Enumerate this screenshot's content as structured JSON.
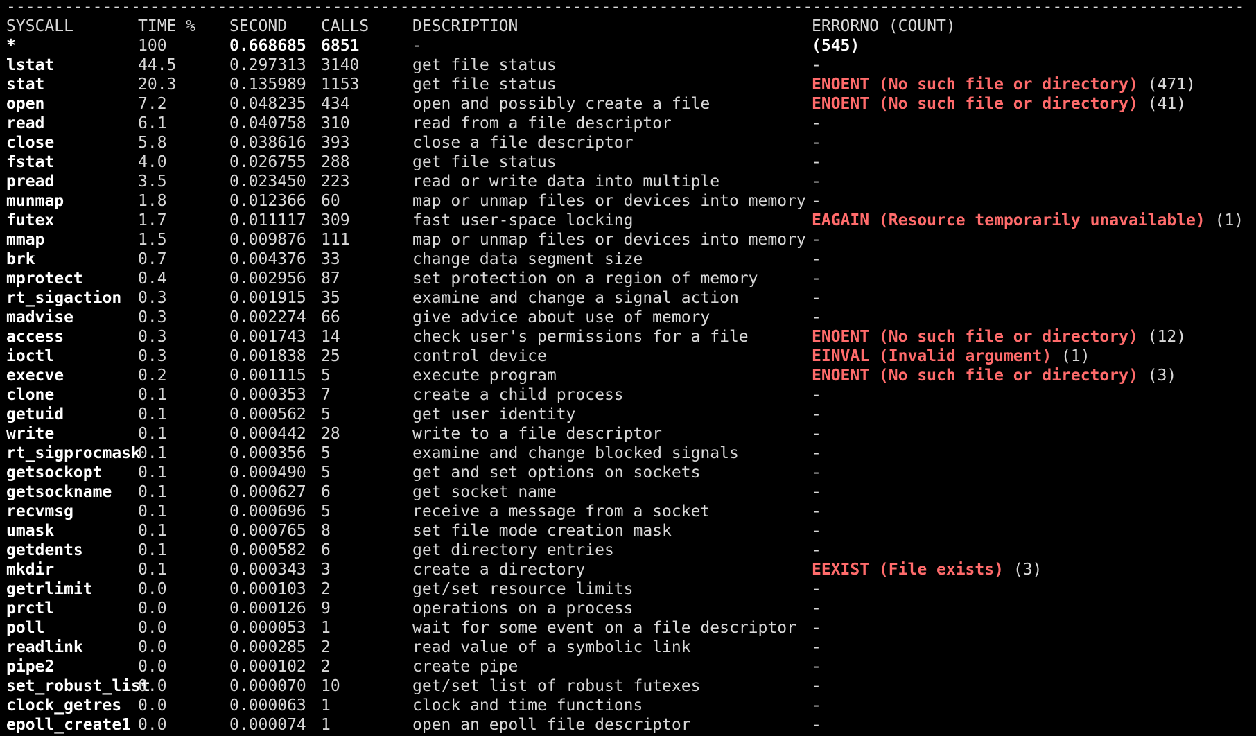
{
  "separator": "----------------------------------------------------------------------------------------------------------------------------------------------------------------------------------------",
  "header": {
    "syscall": "SYSCALL",
    "time": "TIME %",
    "second": "SECOND",
    "calls": "CALLS",
    "description": "DESCRIPTION",
    "errno": "ERRORNO (COUNT)"
  },
  "total": {
    "syscall": "*",
    "time": "100",
    "second": "0.668685",
    "calls": "6851",
    "description": "-",
    "errno": "(545)"
  },
  "rows": [
    {
      "syscall": "lstat",
      "time": "44.5",
      "second": "0.297313",
      "calls": "3140",
      "description": "get file status",
      "err_code": "",
      "err_count": "-"
    },
    {
      "syscall": "stat",
      "time": "20.3",
      "second": "0.135989",
      "calls": "1153",
      "description": "get file status",
      "err_code": "ENOENT (No such file or directory)",
      "err_count": "(471)"
    },
    {
      "syscall": "open",
      "time": "7.2",
      "second": "0.048235",
      "calls": "434",
      "description": "open and possibly create a file",
      "err_code": "ENOENT (No such file or directory)",
      "err_count": "(41)"
    },
    {
      "syscall": "read",
      "time": "6.1",
      "second": "0.040758",
      "calls": "310",
      "description": "read from a file descriptor",
      "err_code": "",
      "err_count": "-"
    },
    {
      "syscall": "close",
      "time": "5.8",
      "second": "0.038616",
      "calls": "393",
      "description": "close a file descriptor",
      "err_code": "",
      "err_count": "-"
    },
    {
      "syscall": "fstat",
      "time": "4.0",
      "second": "0.026755",
      "calls": "288",
      "description": "get file status",
      "err_code": "",
      "err_count": "-"
    },
    {
      "syscall": "pread",
      "time": "3.5",
      "second": "0.023450",
      "calls": "223",
      "description": "read or write data into multiple",
      "err_code": "",
      "err_count": "-"
    },
    {
      "syscall": "munmap",
      "time": "1.8",
      "second": "0.012366",
      "calls": "60",
      "description": "map or unmap files or devices into memory",
      "err_code": "",
      "err_count": "-"
    },
    {
      "syscall": "futex",
      "time": "1.7",
      "second": "0.011117",
      "calls": "309",
      "description": "fast user-space locking",
      "err_code": "EAGAIN (Resource temporarily unavailable)",
      "err_count": "(1)"
    },
    {
      "syscall": "mmap",
      "time": "1.5",
      "second": "0.009876",
      "calls": "111",
      "description": "map or unmap files or devices into memory",
      "err_code": "",
      "err_count": "-"
    },
    {
      "syscall": "brk",
      "time": "0.7",
      "second": "0.004376",
      "calls": "33",
      "description": "change data segment size",
      "err_code": "",
      "err_count": "-"
    },
    {
      "syscall": "mprotect",
      "time": "0.4",
      "second": "0.002956",
      "calls": "87",
      "description": "set protection on a region of memory",
      "err_code": "",
      "err_count": "-"
    },
    {
      "syscall": "rt_sigaction",
      "time": "0.3",
      "second": "0.001915",
      "calls": "35",
      "description": "examine and change a signal action",
      "err_code": "",
      "err_count": "-"
    },
    {
      "syscall": "madvise",
      "time": "0.3",
      "second": "0.002274",
      "calls": "66",
      "description": "give advice about use of memory",
      "err_code": "",
      "err_count": "-"
    },
    {
      "syscall": "access",
      "time": "0.3",
      "second": "0.001743",
      "calls": "14",
      "description": "check user's permissions for a file",
      "err_code": "ENOENT (No such file or directory)",
      "err_count": "(12)"
    },
    {
      "syscall": "ioctl",
      "time": "0.3",
      "second": "0.001838",
      "calls": "25",
      "description": "control device",
      "err_code": "EINVAL (Invalid argument)",
      "err_count": "(1)"
    },
    {
      "syscall": "execve",
      "time": "0.2",
      "second": "0.001115",
      "calls": "5",
      "description": "execute program",
      "err_code": "ENOENT (No such file or directory)",
      "err_count": "(3)"
    },
    {
      "syscall": "clone",
      "time": "0.1",
      "second": "0.000353",
      "calls": "7",
      "description": "create a child process",
      "err_code": "",
      "err_count": "-"
    },
    {
      "syscall": "getuid",
      "time": "0.1",
      "second": "0.000562",
      "calls": "5",
      "description": "get user identity",
      "err_code": "",
      "err_count": "-"
    },
    {
      "syscall": "write",
      "time": "0.1",
      "second": "0.000442",
      "calls": "28",
      "description": "write to a file descriptor",
      "err_code": "",
      "err_count": "-"
    },
    {
      "syscall": "rt_sigprocmask",
      "time": "0.1",
      "second": "0.000356",
      "calls": "5",
      "description": "examine and change blocked signals",
      "err_code": "",
      "err_count": "-"
    },
    {
      "syscall": "getsockopt",
      "time": "0.1",
      "second": "0.000490",
      "calls": "5",
      "description": "get and set options on sockets",
      "err_code": "",
      "err_count": "-"
    },
    {
      "syscall": "getsockname",
      "time": "0.1",
      "second": "0.000627",
      "calls": "6",
      "description": "get socket name",
      "err_code": "",
      "err_count": "-"
    },
    {
      "syscall": "recvmsg",
      "time": "0.1",
      "second": "0.000696",
      "calls": "5",
      "description": "receive a message from a socket",
      "err_code": "",
      "err_count": "-"
    },
    {
      "syscall": "umask",
      "time": "0.1",
      "second": "0.000765",
      "calls": "8",
      "description": "set file mode creation mask",
      "err_code": "",
      "err_count": "-"
    },
    {
      "syscall": "getdents",
      "time": "0.1",
      "second": "0.000582",
      "calls": "6",
      "description": "get directory entries",
      "err_code": "",
      "err_count": "-"
    },
    {
      "syscall": "mkdir",
      "time": "0.1",
      "second": "0.000343",
      "calls": "3",
      "description": "create a directory",
      "err_code": "EEXIST (File exists)",
      "err_count": "(3)"
    },
    {
      "syscall": "getrlimit",
      "time": "0.0",
      "second": "0.000103",
      "calls": "2",
      "description": "get/set resource limits",
      "err_code": "",
      "err_count": "-"
    },
    {
      "syscall": "prctl",
      "time": "0.0",
      "second": "0.000126",
      "calls": "9",
      "description": "operations on a process",
      "err_code": "",
      "err_count": "-"
    },
    {
      "syscall": "poll",
      "time": "0.0",
      "second": "0.000053",
      "calls": "1",
      "description": "wait for some event on a file descriptor",
      "err_code": "",
      "err_count": "-"
    },
    {
      "syscall": "readlink",
      "time": "0.0",
      "second": "0.000285",
      "calls": "2",
      "description": "read value of a symbolic link",
      "err_code": "",
      "err_count": "-"
    },
    {
      "syscall": "pipe2",
      "time": "0.0",
      "second": "0.000102",
      "calls": "2",
      "description": "create pipe",
      "err_code": "",
      "err_count": "-"
    },
    {
      "syscall": "set_robust_list",
      "time": "0.0",
      "second": "0.000070",
      "calls": "10",
      "description": "get/set list of robust futexes",
      "err_code": "",
      "err_count": "-"
    },
    {
      "syscall": "clock_getres",
      "time": "0.0",
      "second": "0.000063",
      "calls": "1",
      "description": "clock and time functions",
      "err_code": "",
      "err_count": "-"
    },
    {
      "syscall": "epoll_create1",
      "time": "0.0",
      "second": "0.000074",
      "calls": "1",
      "description": "open an epoll file descriptor",
      "err_code": "",
      "err_count": "-"
    }
  ],
  "colors": {
    "background": "#000000",
    "text": "#d8d8d8",
    "error": "#ff6b6b"
  }
}
